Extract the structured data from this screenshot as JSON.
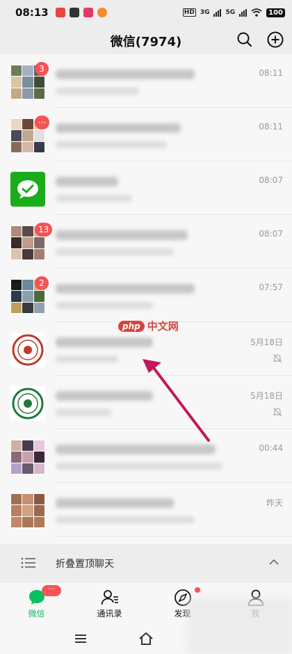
{
  "status_bar": {
    "time": "08:13",
    "notifications": [
      {
        "icon": "app-icon-red",
        "color": "#e8463c"
      },
      {
        "icon": "app-icon-dark",
        "color": "#333333"
      },
      {
        "icon": "app-icon-pink",
        "color": "#e23b6a"
      },
      {
        "icon": "app-icon-orange",
        "color": "#f28a2e"
      }
    ],
    "network_hd": "HD",
    "network_3g": "3G",
    "network_5g": "5G",
    "battery": "100"
  },
  "header": {
    "title": "微信(7974)",
    "search_icon": "search-icon",
    "add_icon": "plus-circle-icon"
  },
  "chats": [
    {
      "time": "08:11",
      "badge": "3",
      "muted": false,
      "avatar_type": "grid",
      "avatar_colors": [
        "#6d7d5a",
        "#a6b0c0",
        "#4a5a78",
        "#d9c6a8",
        "#7b8e9a",
        "#3d4d3a",
        "#c6a882",
        "#8a9aa8",
        "#5a6a4a"
      ]
    },
    {
      "time": "08:11",
      "badge": "···",
      "muted": false,
      "avatar_type": "grid",
      "avatar_colors": [
        "#e8d6c6",
        "#6a4a3a",
        "#f0c0b0",
        "#4a4a5a",
        "#c0a890",
        "#e0e0e0",
        "#8a6a5a",
        "#d6b6a6",
        "#3a3a4a"
      ]
    },
    {
      "time": "08:07",
      "badge": "",
      "muted": false,
      "avatar_type": "wechat-pay",
      "avatar_colors": [
        "#1aad19"
      ]
    },
    {
      "time": "08:07",
      "badge": "13",
      "muted": false,
      "avatar_type": "grid",
      "avatar_colors": [
        "#b08a7a",
        "#5a4a4a",
        "#d6b6a0",
        "#3a2a2a",
        "#c09a8a",
        "#7a6a6a",
        "#e0c0b0",
        "#4a3a3a",
        "#a08070"
      ]
    },
    {
      "time": "07:57",
      "badge": "2",
      "muted": false,
      "avatar_type": "grid",
      "avatar_colors": [
        "#1a1a1a",
        "#6a8aa0",
        "#d0b080",
        "#2a3a4a",
        "#8aa0b0",
        "#4a6a3a",
        "#c0a060",
        "#3a3a3a",
        "#90a0b0"
      ]
    },
    {
      "time": "5月18日",
      "badge": "",
      "muted": true,
      "avatar_type": "seal-red",
      "avatar_colors": [
        "#c0392b"
      ]
    },
    {
      "time": "5月18日",
      "badge": "",
      "muted": true,
      "avatar_type": "seal-green",
      "avatar_colors": [
        "#1e7a3a"
      ]
    },
    {
      "time": "00:44",
      "badge": "",
      "muted": false,
      "avatar_type": "grid",
      "avatar_colors": [
        "#d0b0a0",
        "#4a3a4a",
        "#e8c8d8",
        "#8a6a7a",
        "#c8a0b0",
        "#3a2a3a",
        "#b8a0c8",
        "#6a5a6a",
        "#d8b8c8"
      ]
    },
    {
      "time": "昨天",
      "badge": "",
      "muted": false,
      "avatar_type": "grid",
      "avatar_colors": [
        "#a07050",
        "#c89070",
        "#8a5a40",
        "#b88060",
        "#d0a080",
        "#9a6a4a",
        "#c08868",
        "#a87858",
        "#b07a5a"
      ]
    }
  ],
  "fold": {
    "label": "折叠置顶聊天",
    "menu_icon": "list-icon",
    "chevron_icon": "chevron-up-icon"
  },
  "tabs": [
    {
      "label": "微信",
      "icon": "chat-bubble-icon",
      "active": true,
      "badge": "···"
    },
    {
      "label": "通讯录",
      "icon": "contacts-icon",
      "active": false
    },
    {
      "label": "发现",
      "icon": "compass-icon",
      "active": false,
      "dot": true
    },
    {
      "label": "我",
      "icon": "person-icon",
      "active": false
    }
  ],
  "watermark": {
    "logo": "php",
    "text": "中文网"
  },
  "colors": {
    "accent_green": "#07c160",
    "badge_red": "#f45454",
    "arrow": "#c2185b"
  }
}
